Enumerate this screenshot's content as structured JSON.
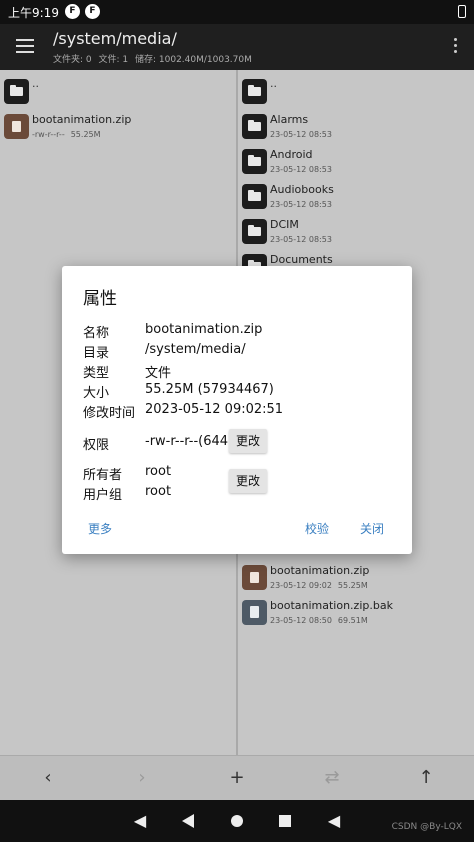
{
  "status_bar": {
    "time": "上午9:19",
    "icon1": "F",
    "icon2": "F"
  },
  "toolbar": {
    "path": "/system/media/",
    "stats": {
      "folders": "文件夹: 0",
      "files": "文件: 1",
      "storage": "储存: 1002.40M/1003.70M"
    }
  },
  "left_pane": {
    "up": "..",
    "files": [
      {
        "name": "bootanimation.zip",
        "perms": "-rw-r--r--",
        "size": "55.25M"
      }
    ]
  },
  "right_pane": {
    "up": "..",
    "folders": [
      {
        "name": "Alarms",
        "date": "23-05-12 08:53"
      },
      {
        "name": "Android",
        "date": "23-05-12 08:53"
      },
      {
        "name": "Audiobooks",
        "date": "23-05-12 08:53"
      },
      {
        "name": "DCIM",
        "date": "23-05-12 08:53"
      },
      {
        "name": "Documents",
        "date": ""
      }
    ],
    "files": [
      {
        "name": "bootanimation.zip",
        "date": "23-05-12 09:02",
        "size": "55.25M"
      },
      {
        "name": "bootanimation.zip.bak",
        "date": "23-05-12 08:50",
        "size": "69.51M"
      }
    ]
  },
  "dialog": {
    "title": "属性",
    "name_label": "名称",
    "name_value": "bootanimation.zip",
    "dir_label": "目录",
    "dir_value": "/system/media/",
    "type_label": "类型",
    "type_value": "文件",
    "size_label": "大小",
    "size_value": "55.25M (57934467)",
    "mtime_label": "修改时间",
    "mtime_value": "2023-05-12 09:02:51",
    "perm_label": "权限",
    "perm_value": "-rw-r--r--(644)",
    "owner_label": "所有者",
    "owner_value": "root",
    "group_label": "用户组",
    "group_value": "root",
    "change_label": "更改",
    "more": "更多",
    "verify": "校验",
    "close": "关闭"
  },
  "bottom_bar": {
    "back": "‹",
    "forward": "›",
    "add": "+",
    "swap": "⇄",
    "up": "↑"
  },
  "watermark": "CSDN @By-LQX",
  "colors": {
    "accent": "#3a7fc1",
    "toolbar": "#1f1f1f",
    "pane": "#c6c6c6"
  }
}
